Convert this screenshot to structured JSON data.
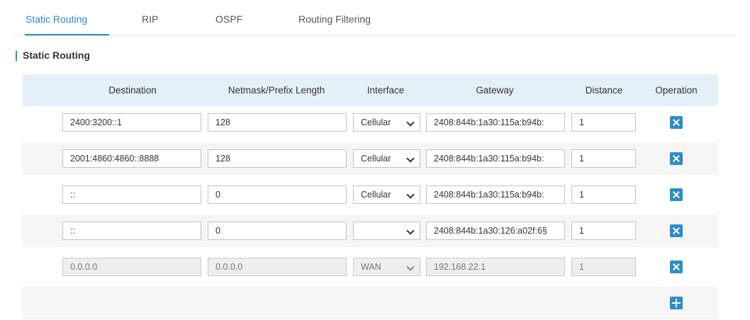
{
  "tabs": [
    {
      "label": "Static Routing",
      "active": true
    },
    {
      "label": "RIP",
      "active": false
    },
    {
      "label": "OSPF",
      "active": false
    },
    {
      "label": "Routing Filtering",
      "active": false
    }
  ],
  "section": {
    "title": "Static Routing"
  },
  "table": {
    "headers": [
      "Destination",
      "Netmask/Prefix Length",
      "Interface",
      "Gateway",
      "Distance",
      "Operation"
    ],
    "rows": [
      {
        "destination": "2400:3200::1",
        "netmask": "128",
        "interface": "Cellular",
        "gateway": "2408:844b:1a30:115a:b94b:",
        "distance": "1",
        "editable": true
      },
      {
        "destination": "2001:4860:4860::8888",
        "netmask": "128",
        "interface": "Cellular",
        "gateway": "2408:844b:1a30:115a:b94b:",
        "distance": "1",
        "editable": true
      },
      {
        "destination": "::",
        "netmask": "0",
        "interface": "Cellular",
        "gateway": "2408:844b:1a30:115a:b94b:",
        "distance": "1",
        "editable": true
      },
      {
        "destination": "::",
        "netmask": "0",
        "interface": "",
        "gateway": "2408:844b:1a30:126:a02f:6§",
        "distance": "1",
        "editable": true
      },
      {
        "destination": "0.0.0.0",
        "netmask": "0.0.0.0",
        "interface": "WAN",
        "gateway": "192.168.22.1",
        "distance": "1",
        "editable": false
      }
    ]
  },
  "icons": {
    "delete": "close-icon",
    "add": "plus-icon"
  },
  "colors": {
    "accent": "#2b8ccc",
    "header_bg": "#e3f0f8",
    "alt_row_bg": "#f5f5f5",
    "disabled_bg": "#eeeeee"
  }
}
